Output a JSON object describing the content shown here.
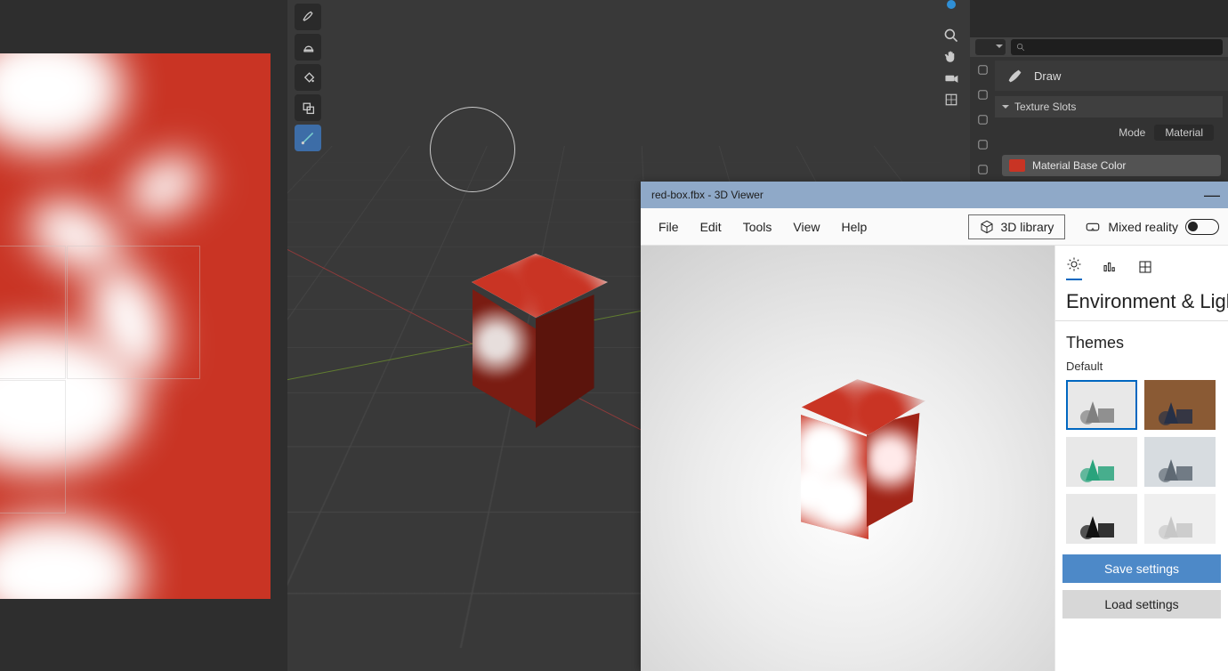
{
  "blender": {
    "tools": [
      {
        "name": "draw-brush",
        "active": false
      },
      {
        "name": "soften-brush",
        "active": false
      },
      {
        "name": "fill-bucket",
        "active": false
      },
      {
        "name": "clone-brush",
        "active": false
      },
      {
        "name": "line-stroke",
        "active": true
      }
    ],
    "nav_icons": [
      "zoom-icon",
      "pan-hand-icon",
      "camera-icon",
      "orthographic-icon"
    ],
    "sidebar_vtabs": [
      "tool-icon",
      "object-icon",
      "output-icon",
      "layers-icon",
      "world-icon"
    ],
    "draw_label": "Draw",
    "texture_panel_title": "Texture Slots",
    "mode_label": "Mode",
    "mode_value": "Material",
    "color_slot_label": "Material Base Color",
    "accent_swatch": "#c93424"
  },
  "viewer": {
    "window_title": "red-box.fbx - 3D Viewer",
    "menu": {
      "file": "File",
      "edit": "Edit",
      "tools": "Tools",
      "view": "View",
      "help": "Help",
      "library": "3D library",
      "mixed_reality": "Mixed reality"
    },
    "side": {
      "tabs": [
        "lighting",
        "stats",
        "grid"
      ],
      "heading": "Environment & Lighting",
      "themes_heading": "Themes",
      "default_label": "Default",
      "themes": [
        {
          "name": "default-theme",
          "fg": "#808080",
          "bg": "#e8e8e8",
          "selected": true
        },
        {
          "name": "wood-theme",
          "fg": "#263047",
          "bg": "#8a5a34",
          "selected": false
        },
        {
          "name": "teal-theme",
          "fg": "#2aa37c",
          "bg": "#e8e8e8",
          "selected": false
        },
        {
          "name": "slate-theme",
          "fg": "#5f6a74",
          "bg": "#d7dce0",
          "selected": false
        },
        {
          "name": "black-theme",
          "fg": "#111111",
          "bg": "#e8e8e8",
          "selected": false
        },
        {
          "name": "lightgrey-theme",
          "fg": "#c7c7c7",
          "bg": "#efefef",
          "selected": false
        }
      ],
      "save_btn": "Save settings",
      "load_btn": "Load settings"
    }
  }
}
